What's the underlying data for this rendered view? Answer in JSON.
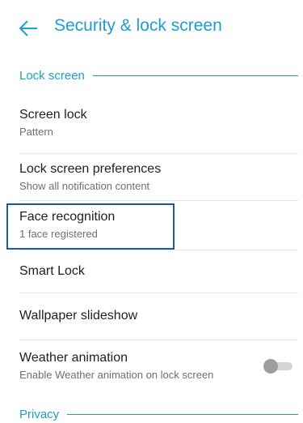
{
  "header": {
    "back_icon": "back-arrow-icon",
    "title": "Security & lock screen"
  },
  "sections": {
    "lock_screen": "Lock screen",
    "privacy": "Privacy"
  },
  "items": [
    {
      "title": "Screen lock",
      "subtitle": "Pattern"
    },
    {
      "title": "Lock screen preferences",
      "subtitle": "Show all notification content"
    },
    {
      "title": "Face recognition",
      "subtitle": "1 face registered"
    },
    {
      "title": "Smart Lock"
    },
    {
      "title": "Wallpaper slideshow"
    },
    {
      "title": "Weather animation",
      "subtitle": "Enable Weather animation on lock screen",
      "toggle_on": false
    }
  ],
  "colors": {
    "accent": "#1a9fd3",
    "highlight_border": "#1f5a96"
  }
}
